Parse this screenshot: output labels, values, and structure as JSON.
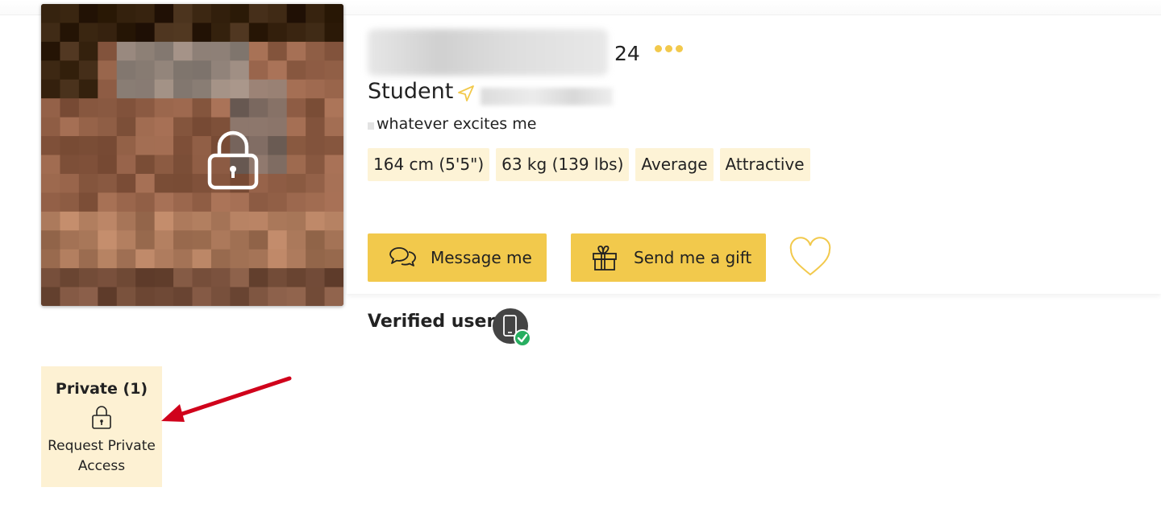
{
  "profile": {
    "age": "24",
    "occupation": "Student",
    "tagline": "whatever excites me",
    "tags": [
      "164 cm (5'5\")",
      "63 kg (139 lbs)",
      "Average",
      "Attractive"
    ]
  },
  "actions": {
    "message_label": "Message me",
    "gift_label": "Send me a gift"
  },
  "verified": {
    "label": "Verified user"
  },
  "private": {
    "title": "Private (1)",
    "request_line1": "Request Private",
    "request_line2": "Access"
  },
  "icons": {
    "photo_lock": "lock-icon",
    "more": "more-dots-icon",
    "location": "navigation-arrow-icon",
    "message": "chat-bubbles-icon",
    "gift": "gift-icon",
    "favorite": "heart-outline-icon",
    "verified": "phone-verified-icon",
    "annotation": "red-arrow"
  },
  "colors": {
    "accent": "#f2c94c",
    "tag_bg": "#fdf3d6",
    "private_bg": "#fdf1d3",
    "verified_check": "#27ae60",
    "annotation_arrow": "#d0021b"
  }
}
